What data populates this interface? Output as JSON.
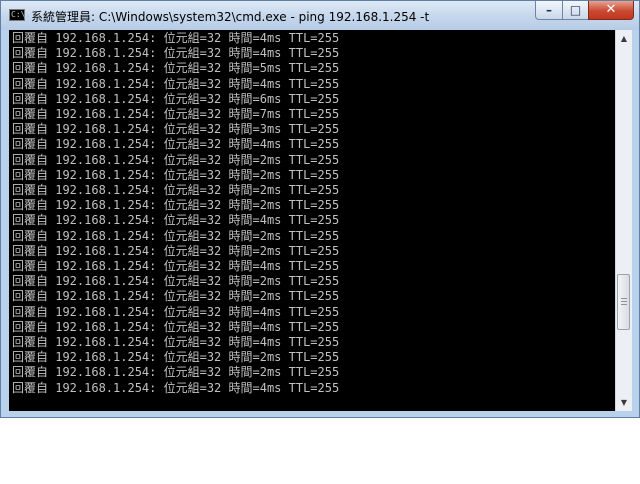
{
  "window": {
    "title": "系統管理員: C:\\Windows\\system32\\cmd.exe - ping  192.168.1.254 -t",
    "icon_text": "C:\\."
  },
  "controls": {
    "minimize": "–",
    "maximize": "□",
    "close": "✕"
  },
  "console": {
    "lines": [
      "回覆自 192.168.1.254: 位元組=32 時間=4ms TTL=255",
      "回覆自 192.168.1.254: 位元組=32 時間=4ms TTL=255",
      "回覆自 192.168.1.254: 位元組=32 時間=5ms TTL=255",
      "回覆自 192.168.1.254: 位元組=32 時間=4ms TTL=255",
      "回覆自 192.168.1.254: 位元組=32 時間=6ms TTL=255",
      "回覆自 192.168.1.254: 位元組=32 時間=7ms TTL=255",
      "回覆自 192.168.1.254: 位元組=32 時間=3ms TTL=255",
      "回覆自 192.168.1.254: 位元組=32 時間=4ms TTL=255",
      "回覆自 192.168.1.254: 位元組=32 時間=2ms TTL=255",
      "回覆自 192.168.1.254: 位元組=32 時間=2ms TTL=255",
      "回覆自 192.168.1.254: 位元組=32 時間=2ms TTL=255",
      "回覆自 192.168.1.254: 位元組=32 時間=2ms TTL=255",
      "回覆自 192.168.1.254: 位元組=32 時間=4ms TTL=255",
      "回覆自 192.168.1.254: 位元組=32 時間=2ms TTL=255",
      "回覆自 192.168.1.254: 位元組=32 時間=2ms TTL=255",
      "回覆自 192.168.1.254: 位元組=32 時間=4ms TTL=255",
      "回覆自 192.168.1.254: 位元組=32 時間=2ms TTL=255",
      "回覆自 192.168.1.254: 位元組=32 時間=2ms TTL=255",
      "回覆自 192.168.1.254: 位元組=32 時間=4ms TTL=255",
      "回覆自 192.168.1.254: 位元組=32 時間=4ms TTL=255",
      "回覆自 192.168.1.254: 位元組=32 時間=4ms TTL=255",
      "回覆自 192.168.1.254: 位元組=32 時間=2ms TTL=255",
      "回覆自 192.168.1.254: 位元組=32 時間=2ms TTL=255",
      "回覆自 192.168.1.254: 位元組=32 時間=4ms TTL=255"
    ]
  },
  "scrollbar": {
    "up_arrow": "▲",
    "down_arrow": "▼",
    "position": 0.78
  },
  "colors": {
    "console_background": "#000000",
    "console_text": "#c0c0c0",
    "close_button": "#c94a34"
  }
}
